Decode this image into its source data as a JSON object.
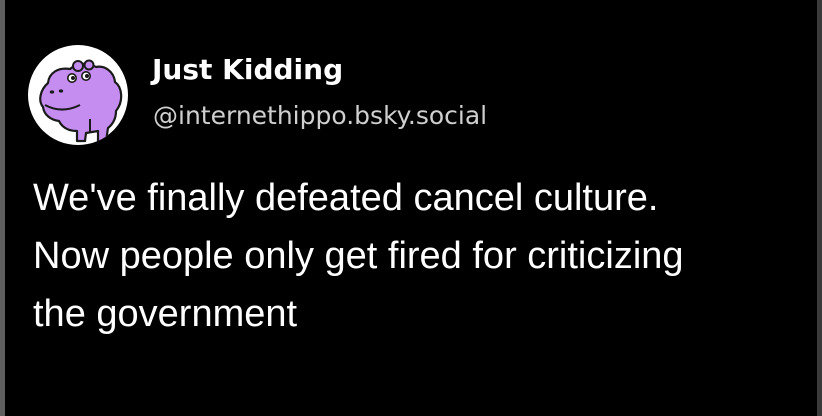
{
  "post": {
    "author": {
      "display_name": "Just Kidding",
      "handle": "@internethippo.bsky.social",
      "avatar_icon": "purple-hippo-avatar"
    },
    "text_lines": [
      "We've finally defeated cancel culture.",
      "Now people only get fired for criticizing",
      "the government"
    ]
  },
  "colors": {
    "background": "#000000",
    "name_text": "#ffffff",
    "handle_text": "#cfcfcf",
    "body_text": "#ffffff",
    "avatar_bg": "#ffffff",
    "hippo_purple": "#c58df0"
  }
}
